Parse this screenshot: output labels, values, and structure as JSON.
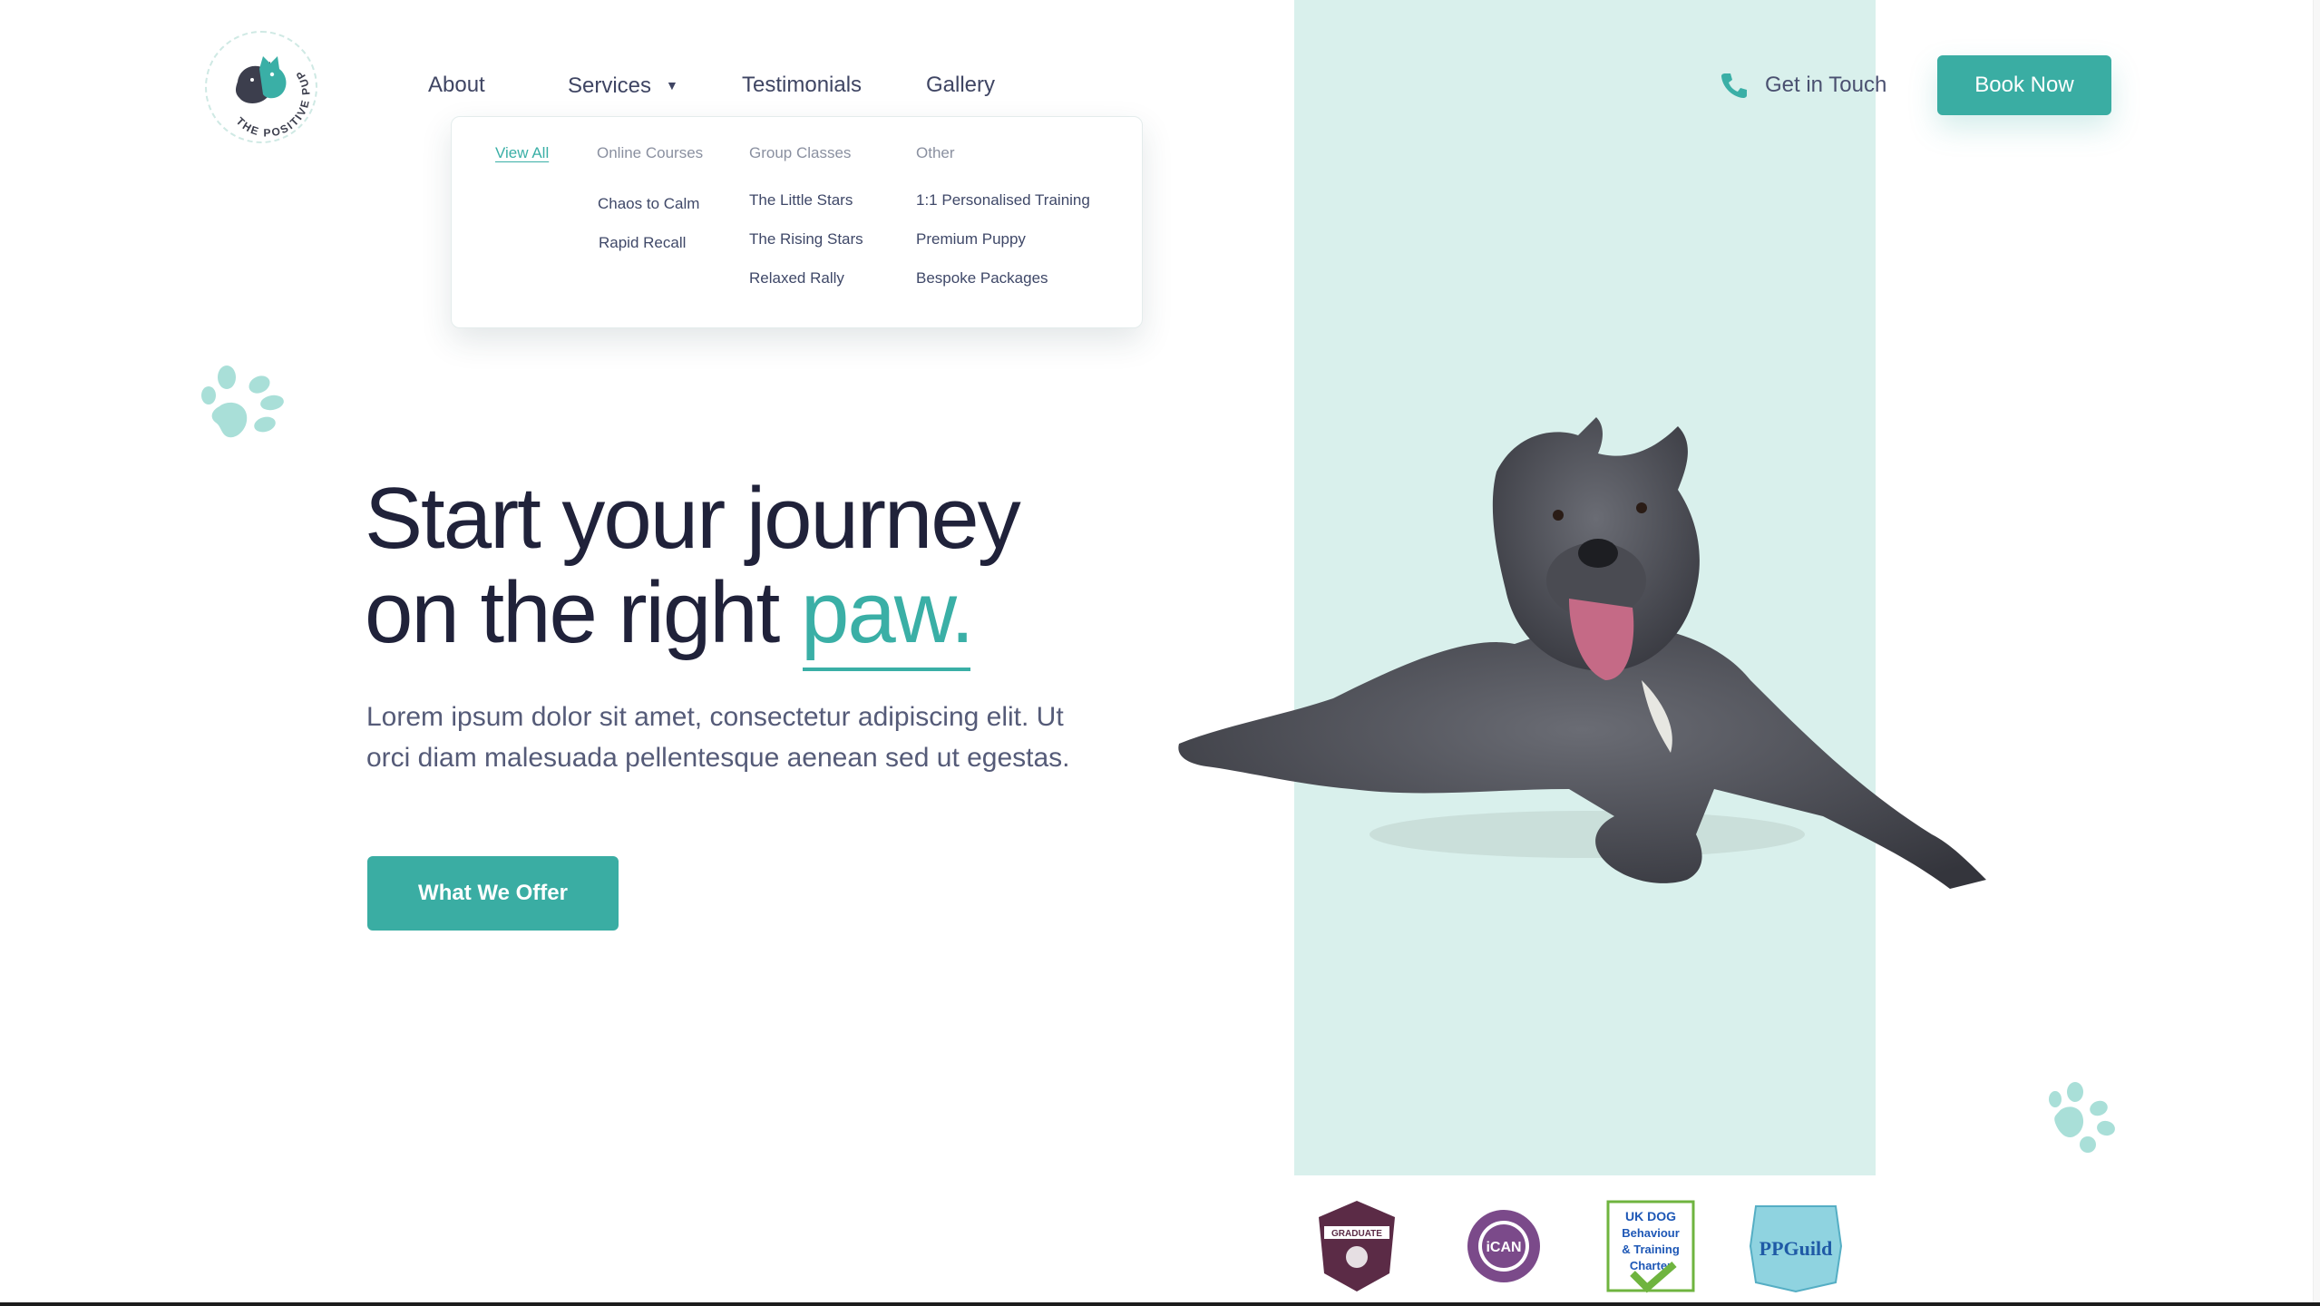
{
  "brand": {
    "logo_text": "THE POSITIVE PUP",
    "colors": {
      "teal": "#3aada3",
      "teal_light": "#d9f0ec",
      "navy": "#20223a"
    }
  },
  "nav": {
    "about": "About",
    "services": "Services",
    "testimonials": "Testimonials",
    "gallery": "Gallery",
    "get_in_touch": "Get in Touch",
    "book_now": "Book Now",
    "phone_icon": "phone-icon",
    "caret_icon": "caret-down-icon"
  },
  "dropdown": {
    "view_all": "View All",
    "columns": [
      {
        "heading": "Online Courses",
        "links": [
          "Chaos to Calm",
          "Rapid Recall"
        ]
      },
      {
        "heading": "Group Classes",
        "links": [
          "The Little Stars",
          "The Rising Stars",
          "Relaxed Rally"
        ]
      },
      {
        "heading": "Other",
        "links": [
          "1:1 Personalised Training",
          "Premium Puppy",
          "Bespoke Packages"
        ]
      }
    ]
  },
  "hero": {
    "title_line1": "Start your journey",
    "title_line2": "on the right",
    "title_accent": "paw.",
    "subtitle": "Lorem ipsum dolor sit amet, consectetur adipiscing elit. Ut orci diam malesuada pellentesque aenean sed ut egestas.",
    "cta": "What We Offer"
  },
  "badges": [
    {
      "icon": "graduate-badge-icon",
      "label": "GRADUATE"
    },
    {
      "icon": "ican-associate-member-badge-icon",
      "label": "iCAN"
    },
    {
      "icon": "uk-dog-behaviour-training-charter-icon",
      "label": "UK DOG Behaviour & Training Charter"
    },
    {
      "icon": "pet-professional-guild-icon",
      "label": "PPGuild"
    }
  ]
}
